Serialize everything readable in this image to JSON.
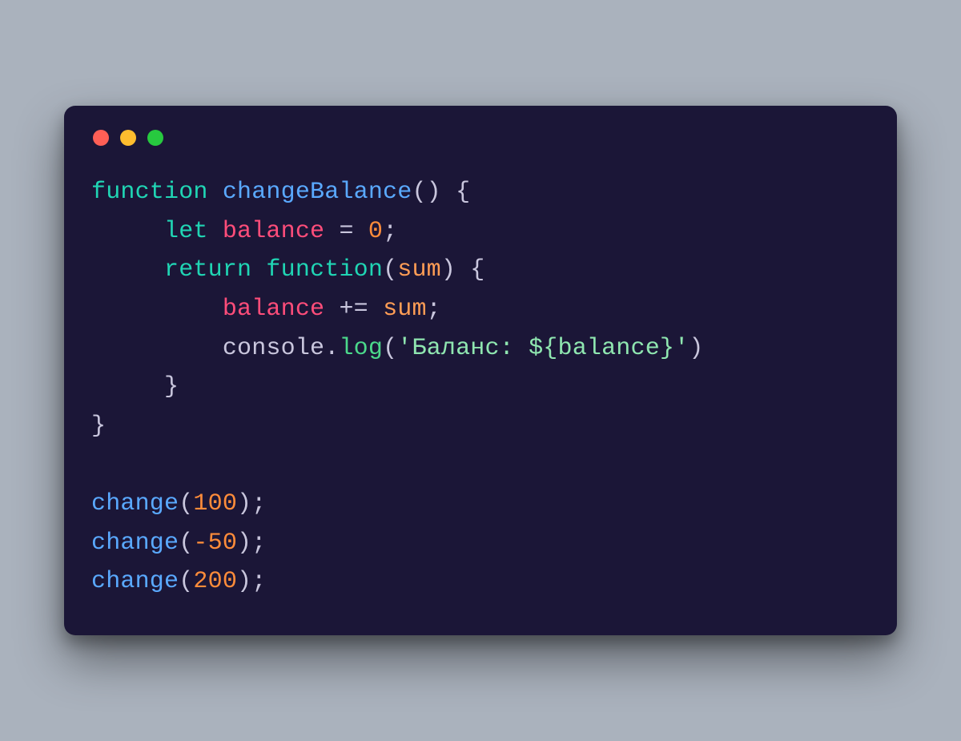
{
  "window": {
    "traffic_light_colors": {
      "red": "#ff5f56",
      "yellow": "#ffbd2e",
      "green": "#27c93f"
    }
  },
  "code": {
    "lines": [
      [
        {
          "cls": "tk-kw",
          "text": "function "
        },
        {
          "cls": "tk-fnname",
          "text": "changeBalance"
        },
        {
          "cls": "tk-punc",
          "text": "() {"
        }
      ],
      [
        {
          "cls": "tk-punc",
          "text": "     "
        },
        {
          "cls": "tk-kw",
          "text": "let "
        },
        {
          "cls": "tk-var",
          "text": "balance"
        },
        {
          "cls": "tk-op",
          "text": " = "
        },
        {
          "cls": "tk-num",
          "text": "0"
        },
        {
          "cls": "tk-punc",
          "text": ";"
        }
      ],
      [
        {
          "cls": "tk-punc",
          "text": "     "
        },
        {
          "cls": "tk-kw",
          "text": "return function"
        },
        {
          "cls": "tk-punc",
          "text": "("
        },
        {
          "cls": "tk-param",
          "text": "sum"
        },
        {
          "cls": "tk-punc",
          "text": ") {"
        }
      ],
      [
        {
          "cls": "tk-punc",
          "text": "         "
        },
        {
          "cls": "tk-var",
          "text": "balance"
        },
        {
          "cls": "tk-op",
          "text": " += "
        },
        {
          "cls": "tk-param",
          "text": "sum"
        },
        {
          "cls": "tk-punc",
          "text": ";"
        }
      ],
      [
        {
          "cls": "tk-punc",
          "text": "         "
        },
        {
          "cls": "tk-obj",
          "text": "console"
        },
        {
          "cls": "tk-punc",
          "text": "."
        },
        {
          "cls": "tk-method",
          "text": "log"
        },
        {
          "cls": "tk-punc",
          "text": "("
        },
        {
          "cls": "tk-str",
          "text": "'Баланс: ${balance}'"
        },
        {
          "cls": "tk-punc",
          "text": ")"
        }
      ],
      [
        {
          "cls": "tk-punc",
          "text": "     }"
        }
      ],
      [
        {
          "cls": "tk-punc",
          "text": "}"
        }
      ],
      [
        {
          "cls": "tk-punc",
          "text": ""
        }
      ],
      [
        {
          "cls": "tk-fnname",
          "text": "change"
        },
        {
          "cls": "tk-punc",
          "text": "("
        },
        {
          "cls": "tk-num",
          "text": "100"
        },
        {
          "cls": "tk-punc",
          "text": ");"
        }
      ],
      [
        {
          "cls": "tk-fnname",
          "text": "change"
        },
        {
          "cls": "tk-punc",
          "text": "("
        },
        {
          "cls": "tk-num",
          "text": "-50"
        },
        {
          "cls": "tk-punc",
          "text": ");"
        }
      ],
      [
        {
          "cls": "tk-fnname",
          "text": "change"
        },
        {
          "cls": "tk-punc",
          "text": "("
        },
        {
          "cls": "tk-num",
          "text": "200"
        },
        {
          "cls": "tk-punc",
          "text": ");"
        }
      ]
    ]
  }
}
